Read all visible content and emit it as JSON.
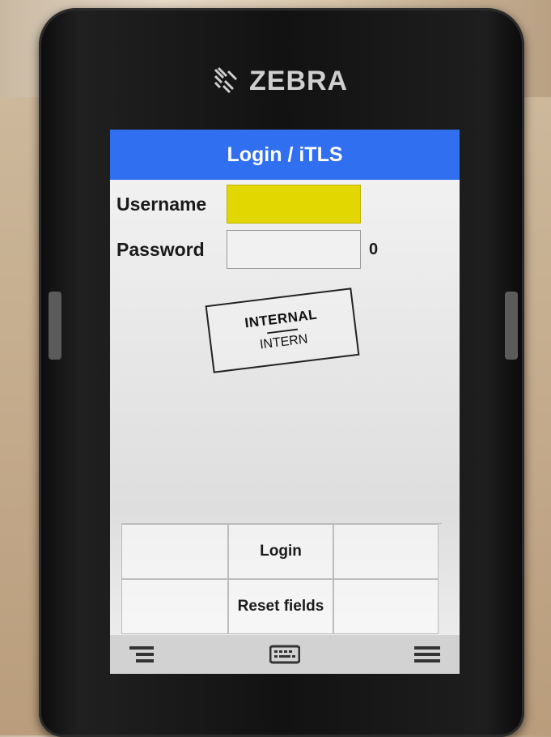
{
  "device": {
    "brand": "ZEBRA"
  },
  "app": {
    "title": "Login / iTLS"
  },
  "login_form": {
    "username_label": "Username",
    "username_value": "",
    "password_label": "Password",
    "password_value": "",
    "password_length": "0"
  },
  "stamp": {
    "line1": "INTERNAL",
    "line2": "INTERN"
  },
  "actions": {
    "login_label": "Login",
    "reset_label": "Reset fields"
  },
  "bottom_bar": {
    "icons": [
      "menu-collapse-icon",
      "keyboard-icon",
      "hamburger-menu-icon"
    ]
  },
  "colors": {
    "title_bar": "#2f6ff0",
    "active_field": "#e2d700",
    "device_body": "#151515"
  }
}
